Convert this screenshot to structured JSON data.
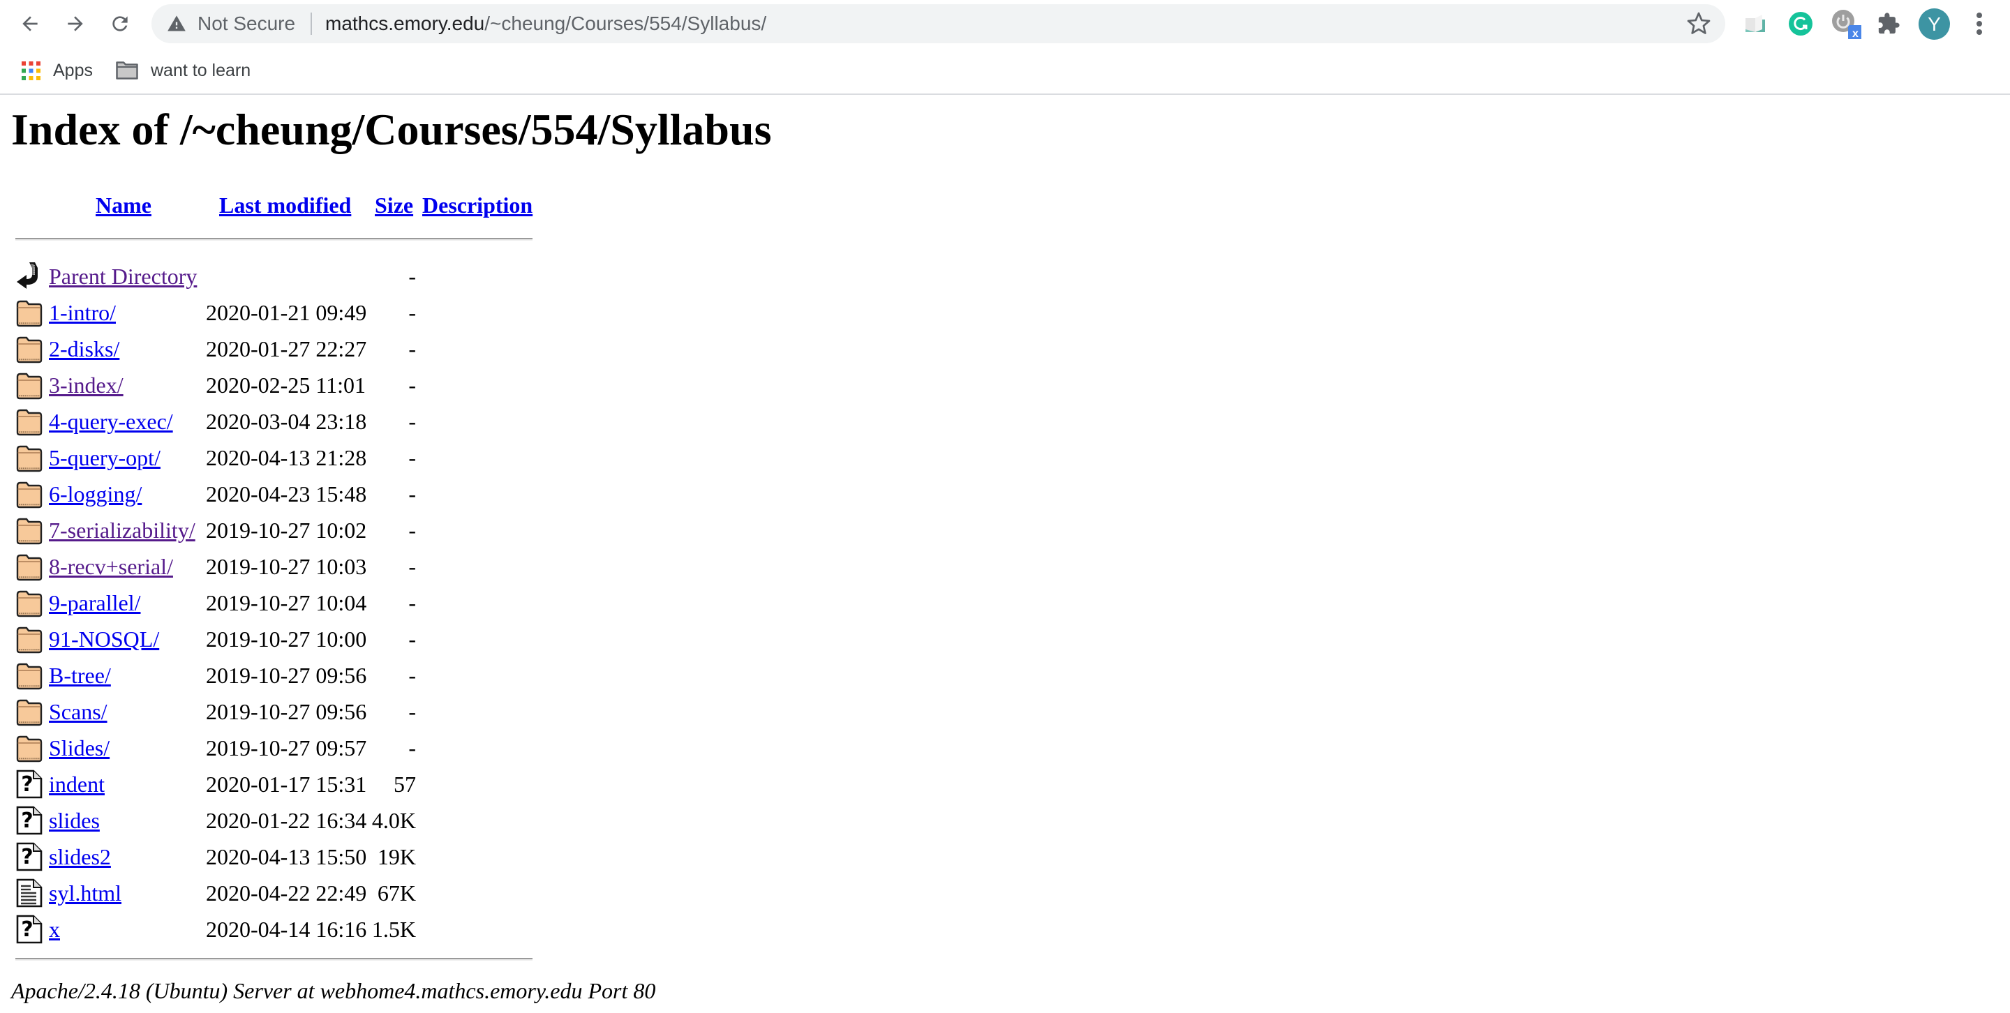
{
  "browser": {
    "nav": {
      "back_icon": "arrow-left-icon",
      "forward_icon": "arrow-right-icon",
      "reload_icon": "reload-icon"
    },
    "omnibox": {
      "security_icon": "warning-triangle-icon",
      "security_label": "Not Secure",
      "url_host": "mathcs.emory.edu",
      "url_path": "/~cheung/Courses/554/Syllabus/",
      "bookmark_icon": "star-icon"
    },
    "extensions": [
      {
        "name": "reader-extension-icon"
      },
      {
        "name": "grammarly-icon",
        "color": "#15c39a"
      },
      {
        "name": "power-extension-icon",
        "badge": "x",
        "badge_color": "#4a86e8"
      },
      {
        "name": "puzzle-extensions-icon"
      }
    ],
    "profile": {
      "initial": "Y",
      "color": "#3d94a3"
    },
    "menu_icon": "kebab-menu-icon",
    "bookmarks": [
      {
        "label": "Apps",
        "icon": "apps-grid-icon"
      },
      {
        "label": "want to learn",
        "icon": "folder-icon"
      }
    ]
  },
  "page": {
    "title": "Index of /~cheung/Courses/554/Syllabus",
    "columns": {
      "name": "Name",
      "last_modified": "Last modified",
      "size": "Size",
      "description": "Description"
    },
    "rows": [
      {
        "icon": "parent-directory-icon",
        "name": "Parent Directory",
        "date": "",
        "size": "-",
        "visited": true
      },
      {
        "icon": "folder-icon",
        "name": "1-intro/",
        "date": "2020-01-21 09:49",
        "size": "-",
        "visited": false
      },
      {
        "icon": "folder-icon",
        "name": "2-disks/",
        "date": "2020-01-27 22:27",
        "size": "-",
        "visited": false
      },
      {
        "icon": "folder-icon",
        "name": "3-index/",
        "date": "2020-02-25 11:01",
        "size": "-",
        "visited": true
      },
      {
        "icon": "folder-icon",
        "name": "4-query-exec/",
        "date": "2020-03-04 23:18",
        "size": "-",
        "visited": false
      },
      {
        "icon": "folder-icon",
        "name": "5-query-opt/",
        "date": "2020-04-13 21:28",
        "size": "-",
        "visited": false
      },
      {
        "icon": "folder-icon",
        "name": "6-logging/",
        "date": "2020-04-23 15:48",
        "size": "-",
        "visited": false
      },
      {
        "icon": "folder-icon",
        "name": "7-serializability/",
        "date": "2019-10-27 10:02",
        "size": "-",
        "visited": true
      },
      {
        "icon": "folder-icon",
        "name": "8-recv+serial/",
        "date": "2019-10-27 10:03",
        "size": "-",
        "visited": true
      },
      {
        "icon": "folder-icon",
        "name": "9-parallel/",
        "date": "2019-10-27 10:04",
        "size": "-",
        "visited": false
      },
      {
        "icon": "folder-icon",
        "name": "91-NOSQL/",
        "date": "2019-10-27 10:00",
        "size": "-",
        "visited": false
      },
      {
        "icon": "folder-icon",
        "name": "B-tree/",
        "date": "2019-10-27 09:56",
        "size": "-",
        "visited": false
      },
      {
        "icon": "folder-icon",
        "name": "Scans/",
        "date": "2019-10-27 09:56",
        "size": "-",
        "visited": false
      },
      {
        "icon": "folder-icon",
        "name": "Slides/",
        "date": "2019-10-27 09:57",
        "size": "-",
        "visited": false
      },
      {
        "icon": "unknown-file-icon",
        "name": "indent",
        "date": "2020-01-17 15:31",
        "size": "57",
        "visited": false
      },
      {
        "icon": "unknown-file-icon",
        "name": "slides",
        "date": "2020-01-22 16:34",
        "size": "4.0K",
        "visited": false
      },
      {
        "icon": "unknown-file-icon",
        "name": "slides2",
        "date": "2020-04-13 15:50",
        "size": "19K",
        "visited": false
      },
      {
        "icon": "text-file-icon",
        "name": "syl.html",
        "date": "2020-04-22 22:49",
        "size": "67K",
        "visited": false
      },
      {
        "icon": "unknown-file-icon",
        "name": "x",
        "date": "2020-04-14 16:16",
        "size": "1.5K",
        "visited": false
      }
    ],
    "footer": "Apache/2.4.18 (Ubuntu) Server at webhome4.mathcs.emory.edu Port 80"
  }
}
